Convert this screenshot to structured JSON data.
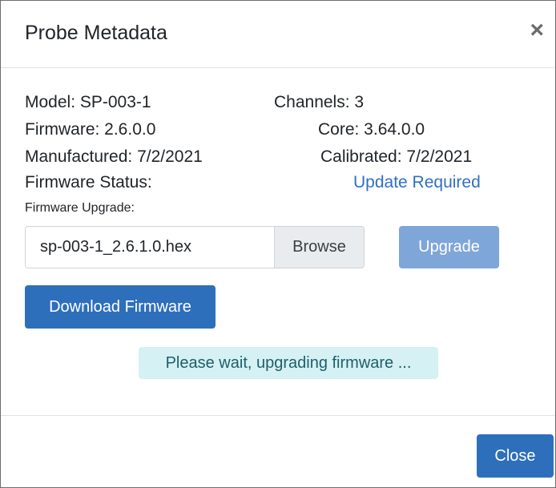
{
  "modal": {
    "title": "Probe Metadata",
    "close_icon": "×"
  },
  "info": {
    "model": "Model: SP-003-1",
    "channels": "Channels: 3",
    "firmware": "Firmware: 2.6.0.0",
    "core": "Core: 3.64.0.0",
    "manufactured": "Manufactured: 7/2/2021",
    "calibrated": "Calibrated: 7/2/2021",
    "firmware_status_label": "Firmware Status:",
    "firmware_status_value": "Update Required",
    "firmware_upgrade_label": "Firmware Upgrade:"
  },
  "upgrade": {
    "file_name": "sp-003-1_2.6.1.0.hex",
    "browse_label": "Browse",
    "upgrade_label": "Upgrade"
  },
  "download_label": "Download Firmware",
  "status_message": "Please wait, upgrading firmware ...",
  "footer": {
    "close_label": "Close"
  },
  "colors": {
    "primary": "#2e6fbc",
    "primary_disabled": "#7fa6d9",
    "link": "#2f70c4",
    "alert_bg": "#d5f1f3"
  }
}
